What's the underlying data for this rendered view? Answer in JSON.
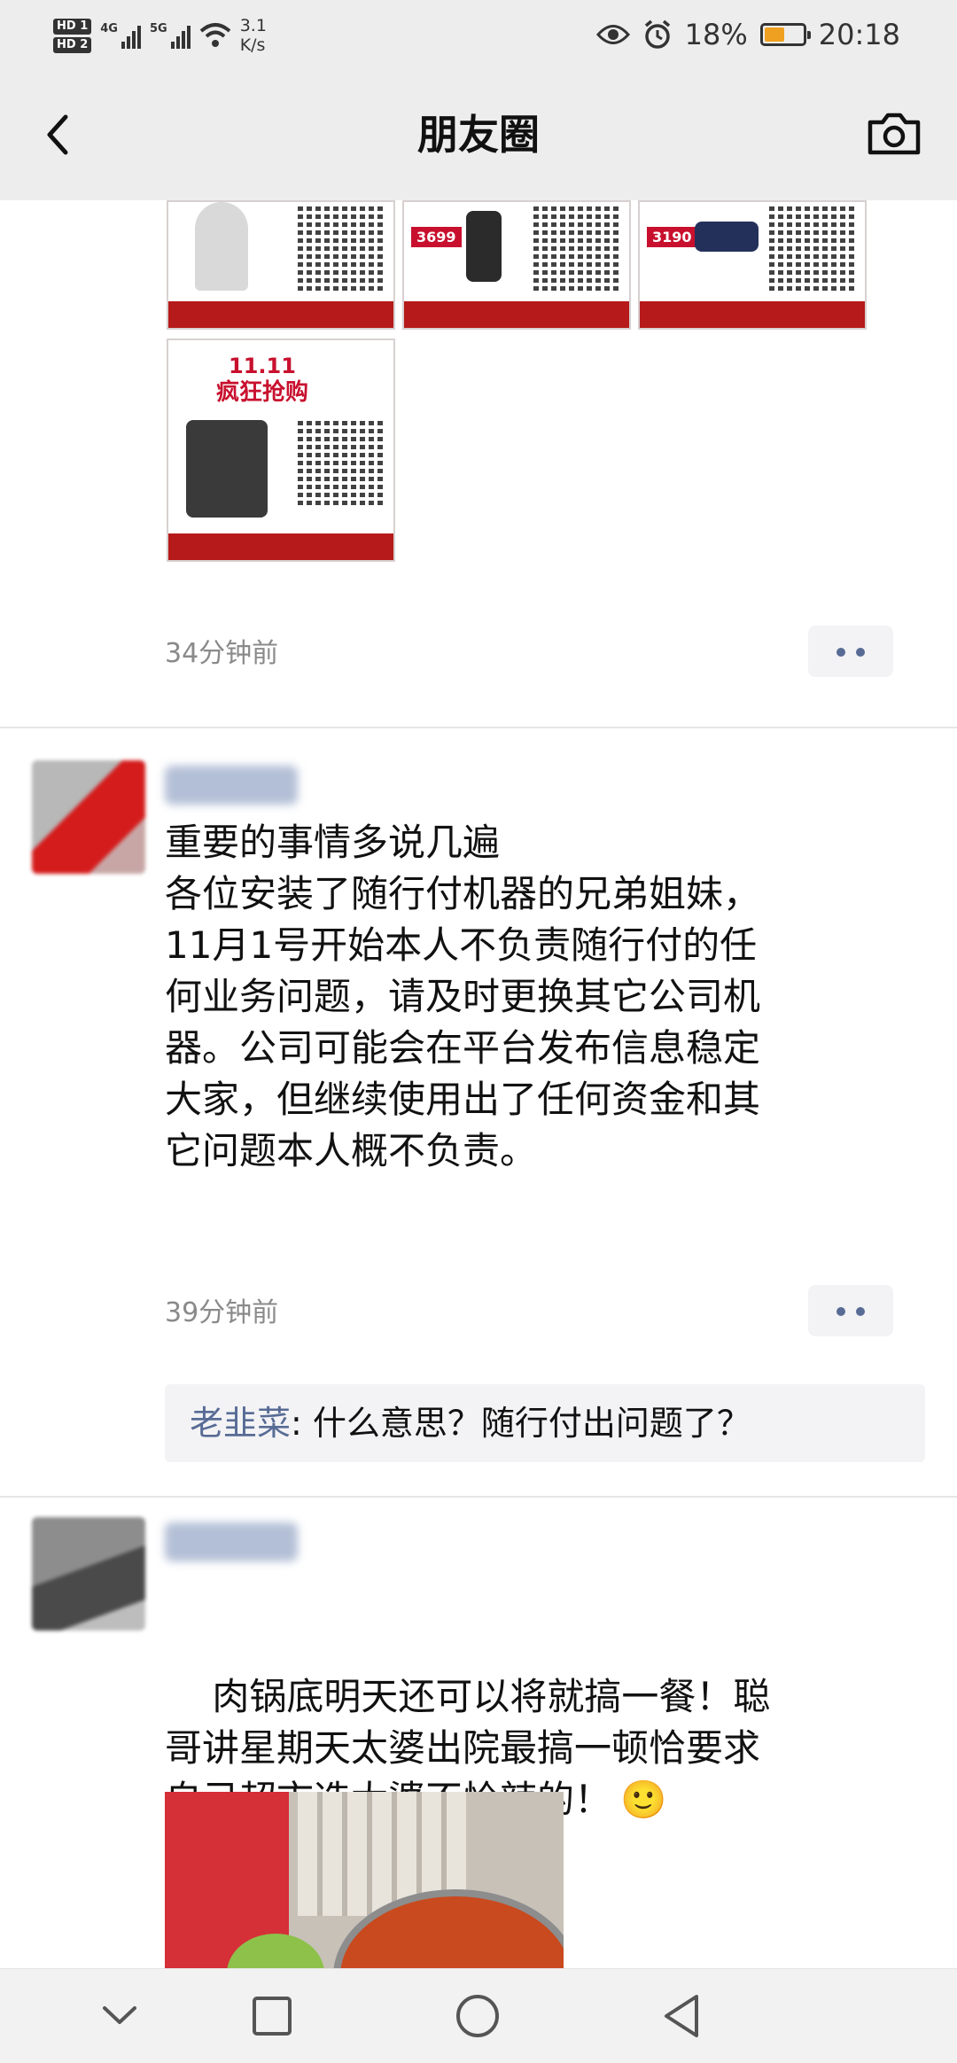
{
  "status_bar": {
    "hd1": "HD 1",
    "hd2": "HD 2",
    "net1": "4G",
    "net2": "5G",
    "speed_value": "3.1",
    "speed_unit": "K/s",
    "battery": "18%",
    "time": "20:18"
  },
  "nav": {
    "title": "朋友圈",
    "back_icon": "chevron-left-icon",
    "camera_icon": "camera-icon"
  },
  "posts": [
    {
      "images": [
        {
          "badge": "",
          "price": ""
        },
        {
          "badge": "",
          "price": "3699"
        },
        {
          "badge": "",
          "price": "3190"
        },
        {
          "badge": "",
          "promo": "11.11\n疯狂抢购"
        }
      ],
      "time": "34分钟前"
    },
    {
      "text": "重要的事情多说几遍\n各位安装了随行付机器的兄弟姐妹，\n11月1号开始本人不负责随行付的任\n何业务问题，请及时更换其它公司机\n器。公司可能会在平台发布信息稳定\n大家，但继续使用出了任何资金和其\n它问题本人概不负责。",
      "time": "39分钟前",
      "comment": {
        "name": "老韭菜",
        "text": ": 什么意思？随行付出问题了？"
      }
    },
    {
      "text": "肉锅底明天还可以将就搞一餐！聪\n哥讲星期天太婆出院最搞一顿恰要求\n自己超市选太婆不恰辣的！",
      "emoji": "🙂"
    }
  ],
  "colors": {
    "link": "#576b95",
    "bar_bg": "#ededed",
    "accent_red": "#c8102e"
  }
}
